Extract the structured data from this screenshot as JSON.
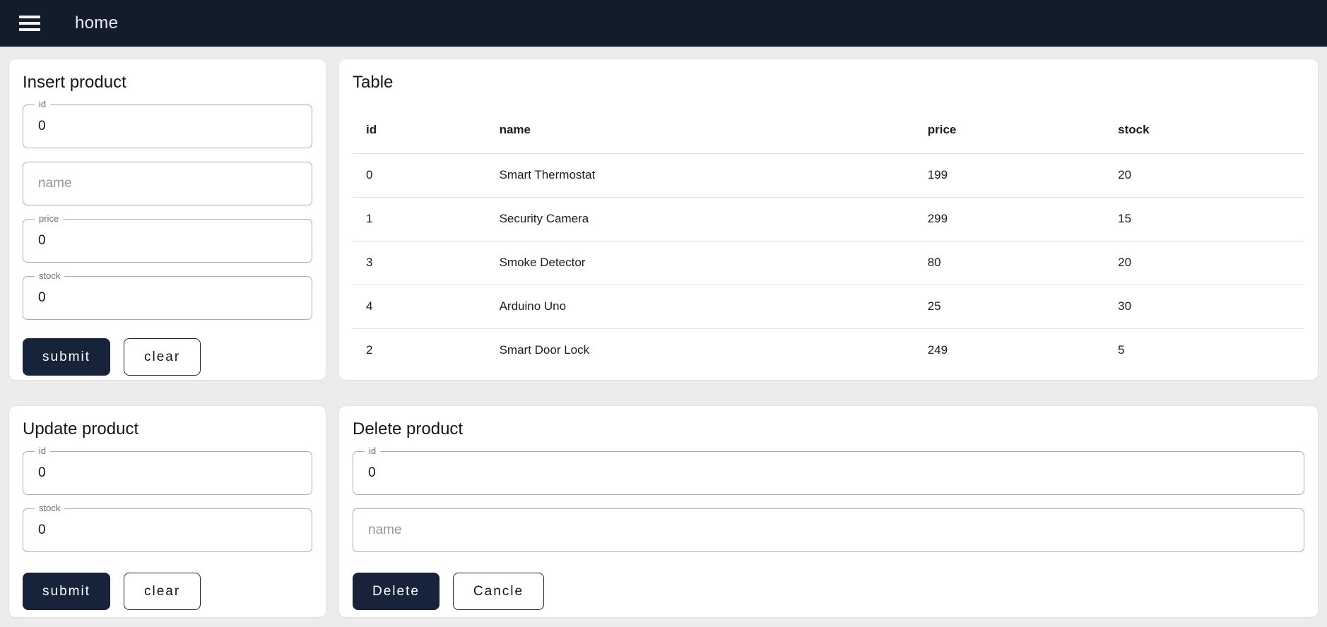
{
  "app_bar": {
    "title": "home",
    "menu_icon": "hamburger-menu-icon"
  },
  "colors": {
    "app_bar_bg": "#121c2b",
    "primary_button_bg": "#17233a",
    "page_bg": "#ececec",
    "panel_bg": "#ffffff",
    "divider": "#e0e0e0"
  },
  "insert_panel": {
    "title": "Insert product",
    "id_field": {
      "label": "id",
      "value": "0"
    },
    "name_field": {
      "placeholder": "name",
      "value": ""
    },
    "price_field": {
      "label": "price",
      "value": "0"
    },
    "stock_field": {
      "label": "stock",
      "value": "0"
    },
    "buttons": {
      "submit": "submit",
      "clear": "clear"
    }
  },
  "table_panel": {
    "title": "Table",
    "columns": [
      "id",
      "name",
      "price",
      "stock"
    ],
    "rows": [
      [
        "0",
        "Smart Thermostat",
        "199",
        "20"
      ],
      [
        "1",
        "Security Camera",
        "299",
        "15"
      ],
      [
        "3",
        "Smoke Detector",
        "80",
        "20"
      ],
      [
        "4",
        "Arduino Uno",
        "25",
        "30"
      ],
      [
        "2",
        "Smart Door Lock",
        "249",
        "5"
      ]
    ]
  },
  "update_panel": {
    "title": "Update product",
    "id_field": {
      "label": "id",
      "value": "0"
    },
    "stock_field": {
      "label": "stock",
      "value": "0"
    },
    "buttons": {
      "submit": "submit",
      "clear": "clear"
    }
  },
  "delete_panel": {
    "title": "Delete product",
    "id_field": {
      "label": "id",
      "value": "0"
    },
    "name_field": {
      "placeholder": "name",
      "value": ""
    },
    "buttons": {
      "delete": "Delete",
      "cancel": "Cancle"
    }
  }
}
